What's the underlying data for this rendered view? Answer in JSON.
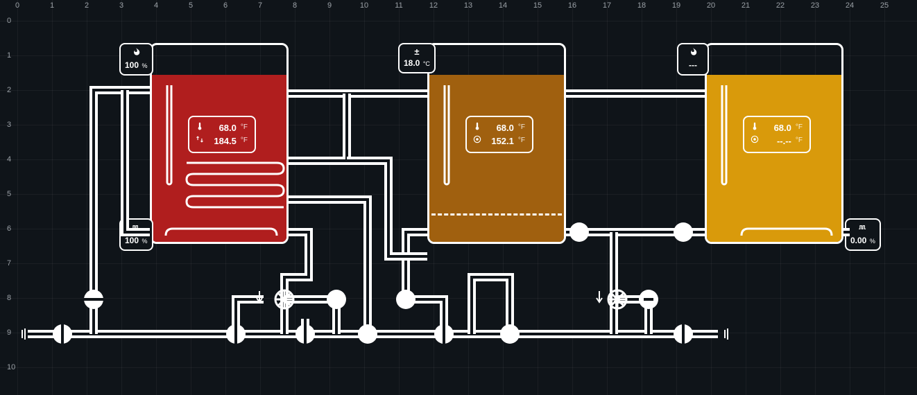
{
  "grid": {
    "x": [
      "0",
      "1",
      "2",
      "3",
      "4",
      "5",
      "6",
      "7",
      "8",
      "9",
      "10",
      "11",
      "12",
      "13",
      "14",
      "15",
      "16",
      "17",
      "18",
      "19",
      "20",
      "21",
      "22",
      "23",
      "24",
      "25"
    ],
    "y": [
      "0",
      "1",
      "2",
      "3",
      "4",
      "5",
      "6",
      "7",
      "8",
      "9",
      "10"
    ]
  },
  "tanks": {
    "a": {
      "color": "#b01e1e",
      "flame": {
        "icon": "flame",
        "value": "100",
        "unit": "%"
      },
      "pwm": {
        "icon": "pwm",
        "value": "100",
        "unit": "%"
      },
      "reading1": {
        "icon": "thermometer",
        "value": "68.0",
        "unit": "°F"
      },
      "reading2": {
        "icon": "exchange-arrows",
        "value": "184.5",
        "unit": "°F"
      }
    },
    "b": {
      "color": "#a0600f",
      "setpoint": {
        "icon": "plus-minus",
        "value": "18.0",
        "unit": "°C"
      },
      "reading1": {
        "icon": "thermometer",
        "value": "68.0",
        "unit": "°F"
      },
      "reading2": {
        "icon": "target",
        "value": "152.1",
        "unit": "°F"
      }
    },
    "c": {
      "color": "#d99a0b",
      "flame": {
        "icon": "flame",
        "value": "---"
      },
      "pwm": {
        "icon": "pwm",
        "value": "0.00",
        "unit": "%"
      },
      "reading1": {
        "icon": "thermometer",
        "value": "68.0",
        "unit": "°F"
      },
      "reading2": {
        "icon": "target",
        "value": "--.--",
        "unit": "°F"
      }
    }
  }
}
